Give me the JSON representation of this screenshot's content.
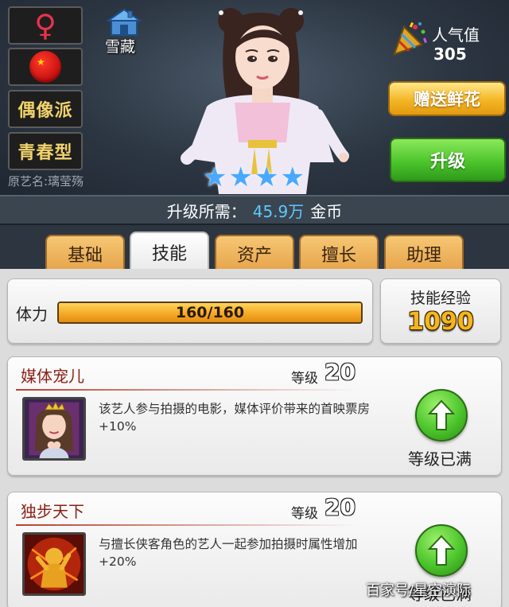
{
  "profile": {
    "gender_symbol": "♀",
    "flag_star": "★",
    "style_tag_1": "偶像派",
    "style_tag_2": "青春型",
    "stage_name": "原艺名:璃莹殇",
    "hidden_label": "雪藏",
    "stars": [
      "★",
      "★",
      "★",
      "★"
    ],
    "popularity_label": "人气值",
    "popularity_value": "305"
  },
  "actions": {
    "gift_label": "赠送鲜花",
    "upgrade_label": "升级"
  },
  "cost": {
    "label": "升级所需：",
    "value": "45.9万",
    "unit": "金币"
  },
  "tabs": [
    {
      "label": "基础",
      "active": false
    },
    {
      "label": "技能",
      "active": true
    },
    {
      "label": "资产",
      "active": false
    },
    {
      "label": "擅长",
      "active": false
    },
    {
      "label": "助理",
      "active": false
    }
  ],
  "stamina": {
    "label": "体力",
    "text": "160/160",
    "fraction": 1.0
  },
  "skill_exp": {
    "label": "技能经验",
    "value": "1090"
  },
  "skills": [
    {
      "name": "媒体宠儿",
      "level_label": "等级",
      "level": "20",
      "description": "该艺人参与拍摄的电影，媒体评价带来的首映票房+10%",
      "status": "等级已满"
    },
    {
      "name": "独步天下",
      "level_label": "等级",
      "level": "20",
      "description": "与擅长侠客角色的艺人一起参加拍摄时属性增加+20%",
      "status": "等级已满"
    }
  ],
  "watermark": "百家号/星空演际",
  "colors": {
    "accent_gold": "#f5b51c",
    "upgrade_green": "#4cc52c",
    "cost_blue": "#5ec8ff",
    "skill_name_red": "#8a1f14"
  }
}
